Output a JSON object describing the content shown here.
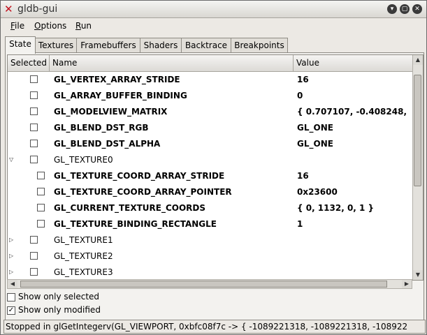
{
  "window": {
    "title": "gldb-gui",
    "app_icon": "x-logo-icon"
  },
  "menubar": {
    "items": [
      {
        "label": "File",
        "mnemonic": "F",
        "rest": "ile"
      },
      {
        "label": "Options",
        "mnemonic": "O",
        "rest": "ptions"
      },
      {
        "label": "Run",
        "mnemonic": "R",
        "rest": "un"
      }
    ]
  },
  "tabs": [
    "State",
    "Textures",
    "Framebuffers",
    "Shaders",
    "Backtrace",
    "Breakpoints"
  ],
  "active_tab": "State",
  "table": {
    "headers": {
      "selected": "Selected",
      "name": "Name",
      "value": "Value"
    },
    "rows": [
      {
        "name": "GL_VERTEX_ARRAY_STRIDE",
        "value": "16",
        "level": 1,
        "bold": true
      },
      {
        "name": "GL_ARRAY_BUFFER_BINDING",
        "value": "0",
        "level": 1,
        "bold": true
      },
      {
        "name": "GL_MODELVIEW_MATRIX",
        "value": "{ 0.707107, -0.408248,",
        "level": 1,
        "bold": true
      },
      {
        "name": "GL_BLEND_DST_RGB",
        "value": "GL_ONE",
        "level": 1,
        "bold": true
      },
      {
        "name": "GL_BLEND_DST_ALPHA",
        "value": "GL_ONE",
        "level": 1,
        "bold": true
      },
      {
        "name": "GL_TEXTURE0",
        "value": "",
        "level": 0,
        "bold": false,
        "expander": "expanded"
      },
      {
        "name": "GL_TEXTURE_COORD_ARRAY_STRIDE",
        "value": "16",
        "level": 2,
        "bold": true
      },
      {
        "name": "GL_TEXTURE_COORD_ARRAY_POINTER",
        "value": "0x23600",
        "level": 2,
        "bold": true
      },
      {
        "name": "GL_CURRENT_TEXTURE_COORDS",
        "value": "{ 0, 1132, 0, 1 }",
        "level": 2,
        "bold": true
      },
      {
        "name": "GL_TEXTURE_BINDING_RECTANGLE",
        "value": "1",
        "level": 2,
        "bold": true
      },
      {
        "name": "GL_TEXTURE1",
        "value": "",
        "level": 0,
        "bold": false,
        "expander": "collapsed"
      },
      {
        "name": "GL_TEXTURE2",
        "value": "",
        "level": 0,
        "bold": false,
        "expander": "collapsed"
      },
      {
        "name": "GL_TEXTURE3",
        "value": "",
        "level": 0,
        "bold": false,
        "expander": "collapsed"
      }
    ]
  },
  "options": {
    "show_only_selected": {
      "label": "Show only selected",
      "checked": false
    },
    "show_only_modified": {
      "label": "Show only modified",
      "checked": true
    }
  },
  "status": "Stopped in glGetIntegerv(GL_VIEWPORT, 0xbfc08f7c -> { -1089221318, -1089221318, -108922"
}
